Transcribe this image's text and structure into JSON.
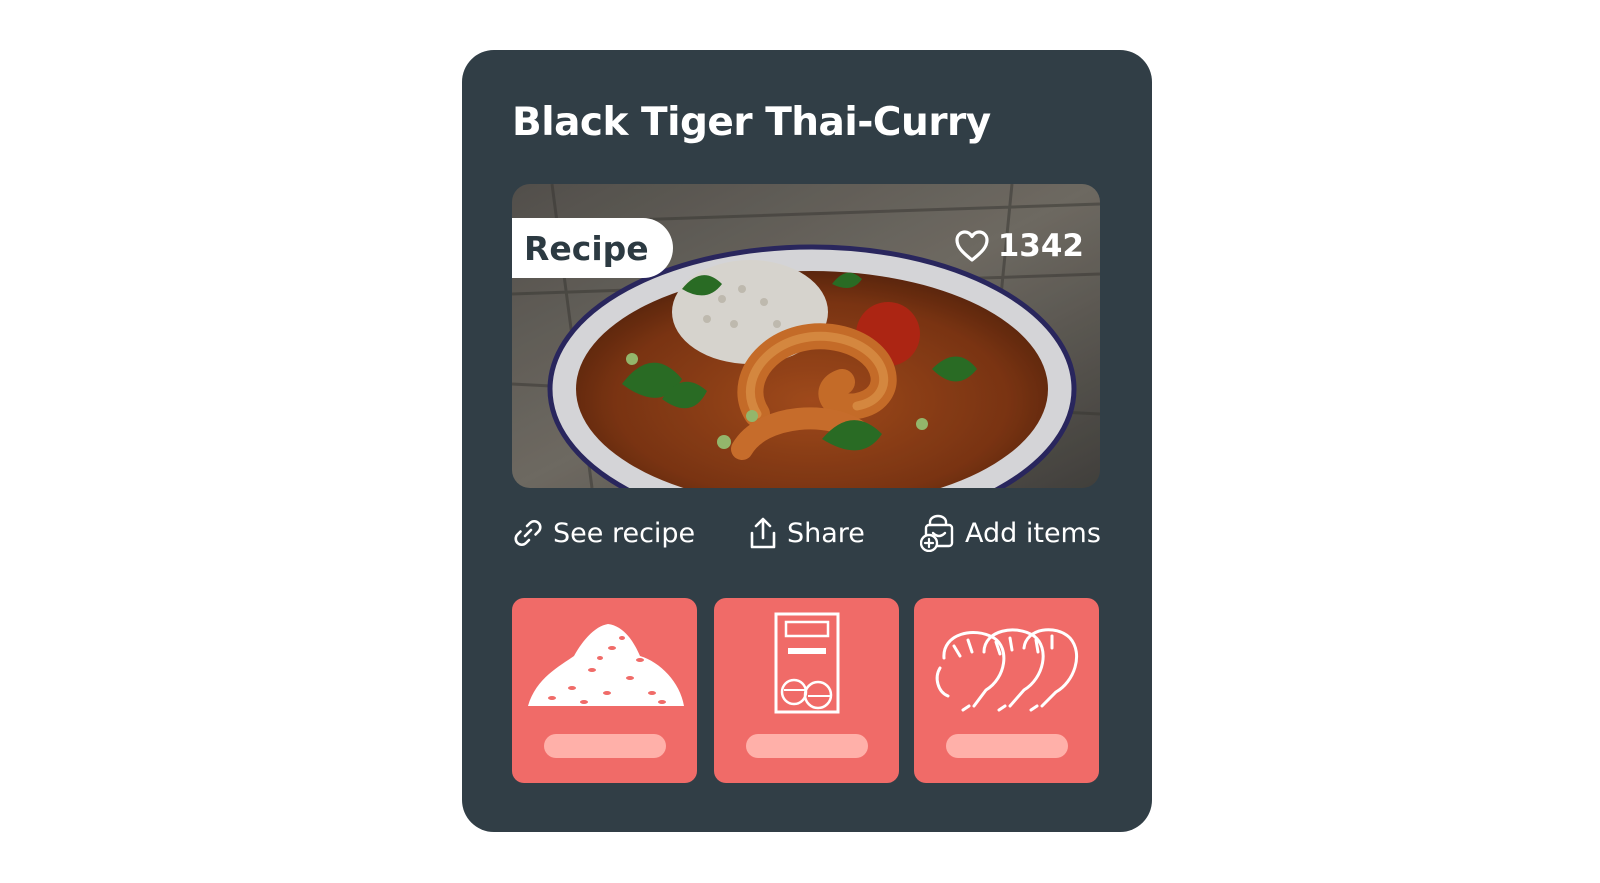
{
  "card": {
    "title": "Black Tiger Thai-Curry",
    "badge": "Recipe",
    "likes": "1342"
  },
  "actions": [
    {
      "label": "See recipe",
      "icon": "link-icon"
    },
    {
      "label": "Share",
      "icon": "share-icon"
    },
    {
      "label": "Add items",
      "icon": "basket-add-icon"
    }
  ],
  "ingredients": [
    {
      "icon": "rice-illustration"
    },
    {
      "icon": "curry-paste-package-illustration"
    },
    {
      "icon": "shrimp-illustration"
    }
  ],
  "colors": {
    "card_background": "#313e46",
    "tile_background": "#f06b68",
    "tile_placeholder": "#ffb0a9",
    "badge_background": "#ffffff",
    "badge_text": "#2c3a42"
  }
}
